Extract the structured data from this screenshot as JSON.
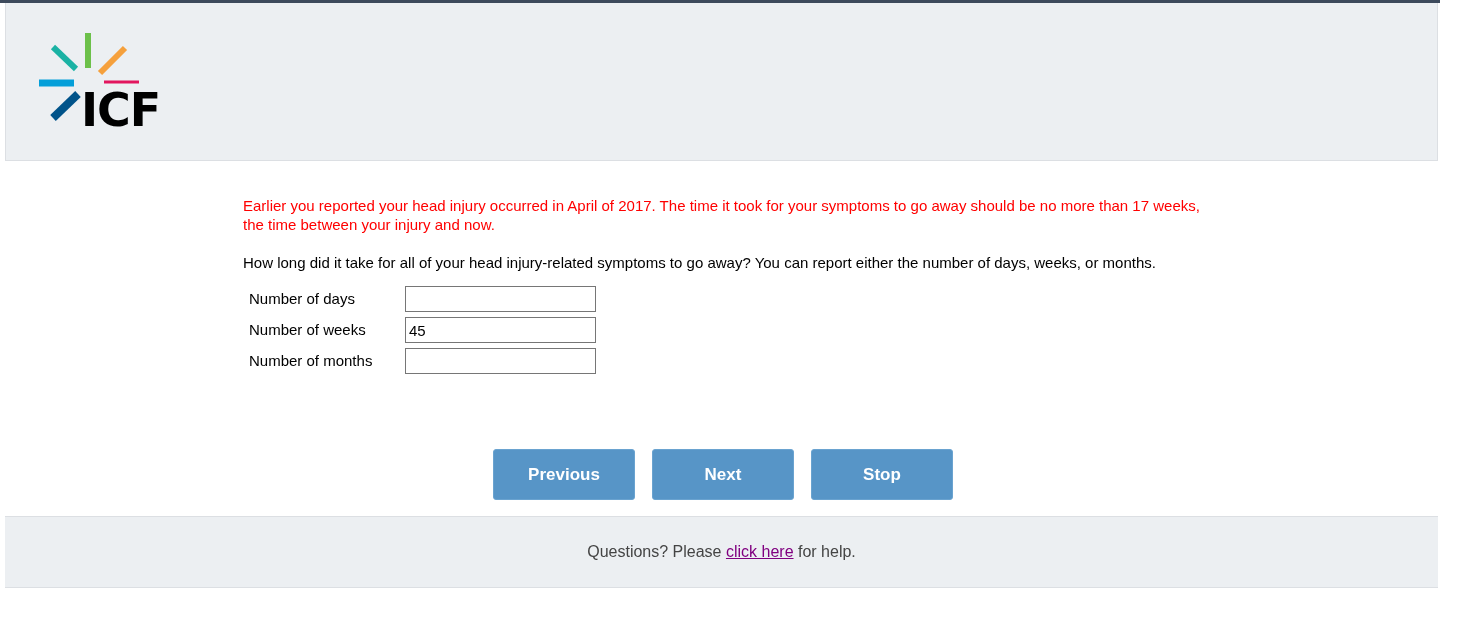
{
  "logo": {
    "text": "ICF"
  },
  "notice": "Earlier you reported your head injury occurred in April of 2017. The time it took for your symptoms to go away should be no more than 17 weeks, the time between your injury and now.",
  "question": "How long did it take for all of your head injury-related symptoms to go away? You can report either the number of days, weeks, or months.",
  "fields": [
    {
      "label": "Number of days"
    },
    {
      "label": "Number of weeks",
      "value": "45"
    },
    {
      "label": "Number of months"
    }
  ],
  "buttons": [
    "Previous",
    "Next",
    "Stop"
  ],
  "footer": {
    "before": "Questions? Please",
    "link": "click here",
    "after": "for help."
  }
}
